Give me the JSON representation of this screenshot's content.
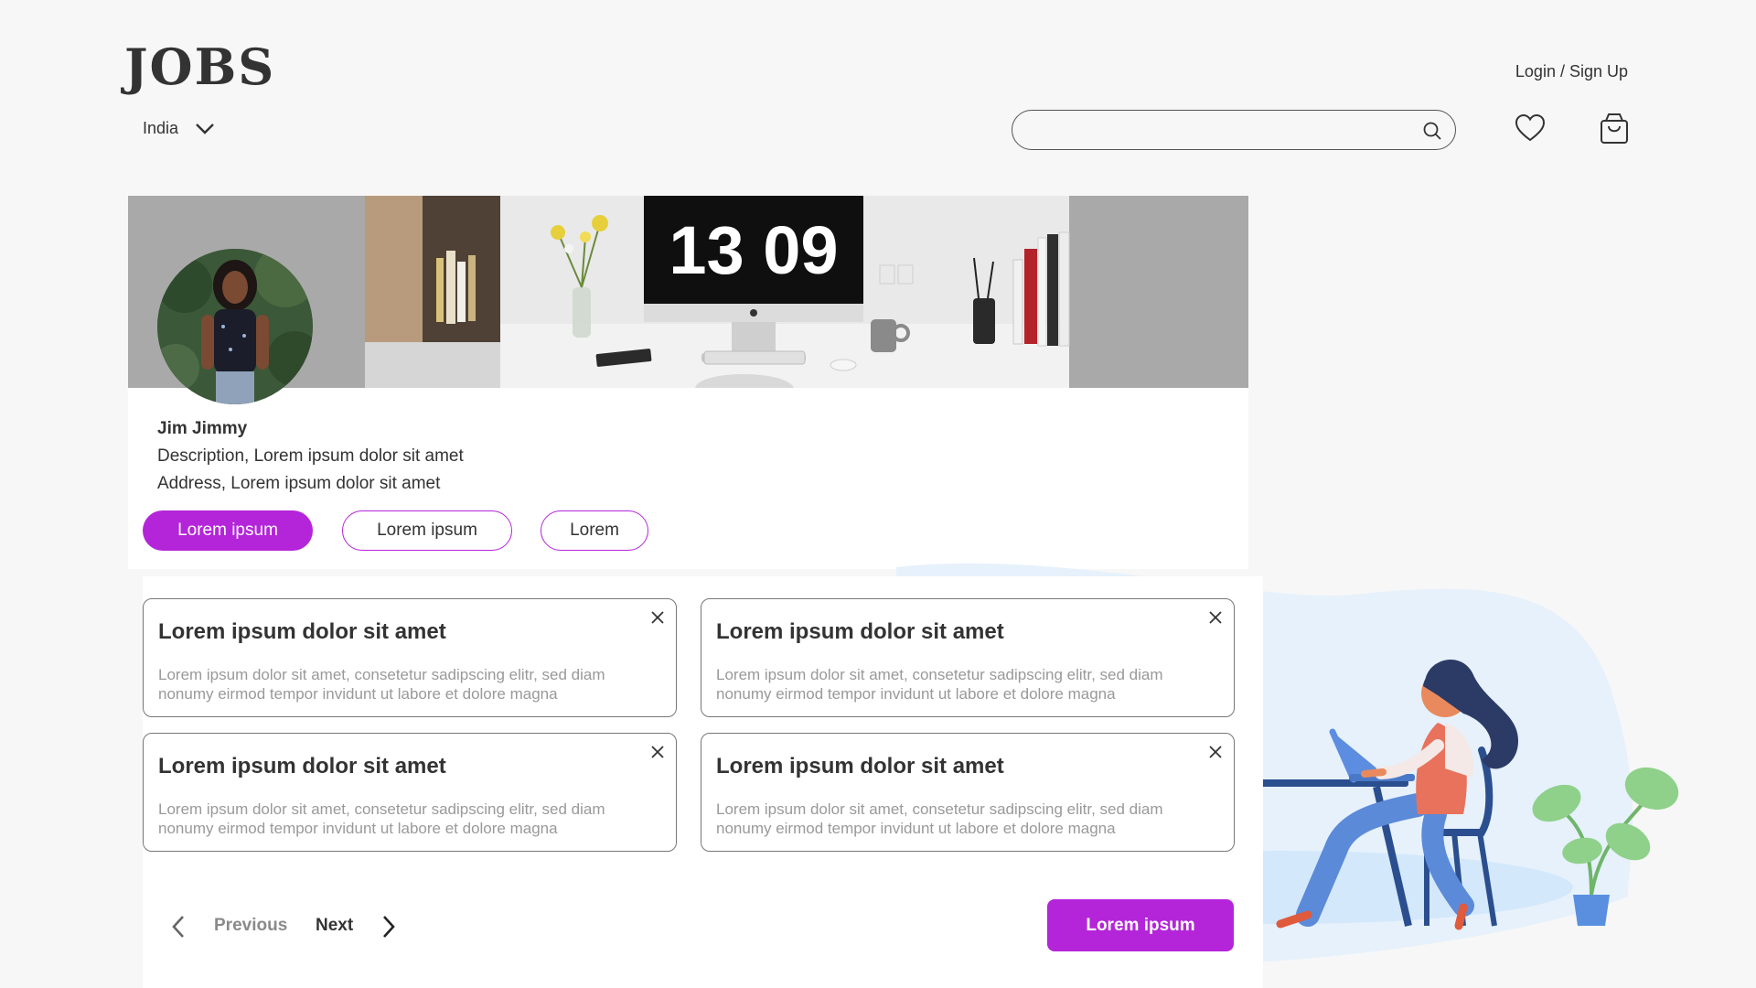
{
  "header": {
    "logo": "JOBS",
    "country": "India",
    "login": "Login / Sign Up",
    "search": {
      "placeholder": "",
      "value": ""
    }
  },
  "cover": {
    "clock_time": "13 09"
  },
  "profile": {
    "name": "Jim Jimmy",
    "description": "Description, Lorem ipsum dolor sit amet",
    "address": "Address, Lorem ipsum dolor sit amet",
    "buttons": [
      {
        "label": "Lorem ipsum",
        "active": true
      },
      {
        "label": "Lorem ipsum",
        "active": false
      },
      {
        "label": "Lorem",
        "active": false
      }
    ]
  },
  "cards": [
    {
      "title": "Lorem ipsum dolor sit amet",
      "body": "Lorem ipsum dolor sit amet, consetetur sadipscing elitr, sed diam nonumy eirmod tempor invidunt ut labore et dolore magna"
    },
    {
      "title": "Lorem ipsum dolor sit amet",
      "body": "Lorem ipsum dolor sit amet, consetetur sadipscing elitr, sed diam nonumy eirmod tempor invidunt ut labore et dolore magna"
    },
    {
      "title": "Lorem ipsum dolor sit amet",
      "body": "Lorem ipsum dolor sit amet, consetetur sadipscing elitr, sed diam nonumy eirmod tempor invidunt ut labore et dolore magna"
    },
    {
      "title": "Lorem ipsum dolor sit amet",
      "body": "Lorem ipsum dolor sit amet, consetetur sadipscing elitr, sed diam nonumy eirmod tempor invidunt ut labore et dolore magna"
    }
  ],
  "pagination": {
    "previous": "Previous",
    "next": "Next"
  },
  "cta": {
    "label": "Lorem ipsum"
  },
  "icons": [
    "chevron-down-icon",
    "search-icon",
    "heart-icon",
    "shopping-bag-icon",
    "close-icon",
    "chevron-left-icon",
    "chevron-right-icon"
  ],
  "colors": {
    "accent": "#b425d9",
    "background": "#f7f7f7",
    "text": "#333333",
    "muted": "#999999"
  }
}
